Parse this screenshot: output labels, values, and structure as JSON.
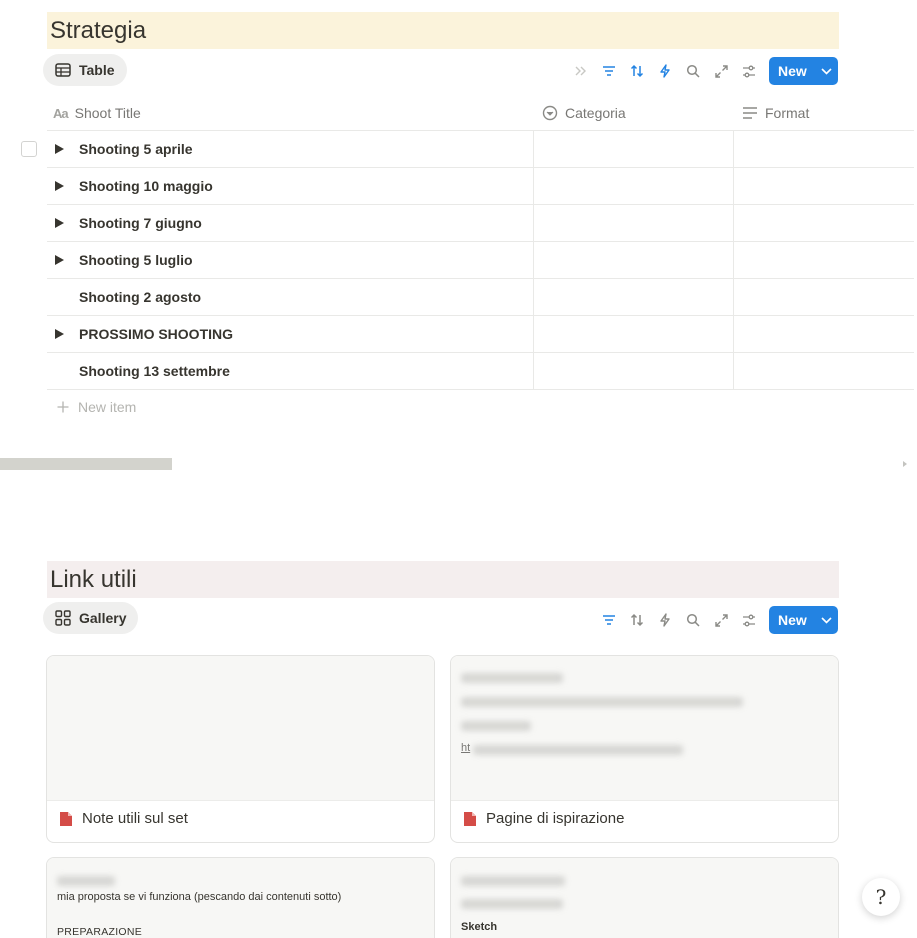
{
  "strategia": {
    "title": "Strategia",
    "title_bg": "#fbf3db",
    "view_label": "Table",
    "new_label": "New",
    "columns": {
      "title": "Shoot Title",
      "categoria": "Categoria",
      "format": "Format"
    },
    "rows": [
      {
        "title": "Shooting 5 aprile",
        "expandable": true
      },
      {
        "title": "Shooting 10 maggio",
        "expandable": true
      },
      {
        "title": "Shooting 7 giugno",
        "expandable": true
      },
      {
        "title": "Shooting 5 luglio",
        "expandable": true
      },
      {
        "title": "Shooting 2 agosto",
        "expandable": false
      },
      {
        "title": "PROSSIMO SHOOTING",
        "expandable": true
      },
      {
        "title": "Shooting 13 settembre",
        "expandable": false
      }
    ],
    "new_item_label": "New item"
  },
  "link_utili": {
    "title": "Link utili",
    "title_bg": "#f4eeee",
    "view_label": "Gallery",
    "new_label": "New",
    "cards": [
      {
        "title": "Note utili sul set"
      },
      {
        "title": "Pagine di ispirazione",
        "preview_link_prefix": "ht"
      },
      {
        "preview_text": "mia proposta se vi funziona (pescando dai contenuti sotto)",
        "preview_heading": "PREPARAZIONE"
      },
      {
        "preview_heading": "Sketch"
      }
    ]
  },
  "help_glyph": "?",
  "colors": {
    "accent": "#2383e2",
    "page_icon": "#d44c47",
    "text": "#37352f",
    "muted": "#787774"
  }
}
